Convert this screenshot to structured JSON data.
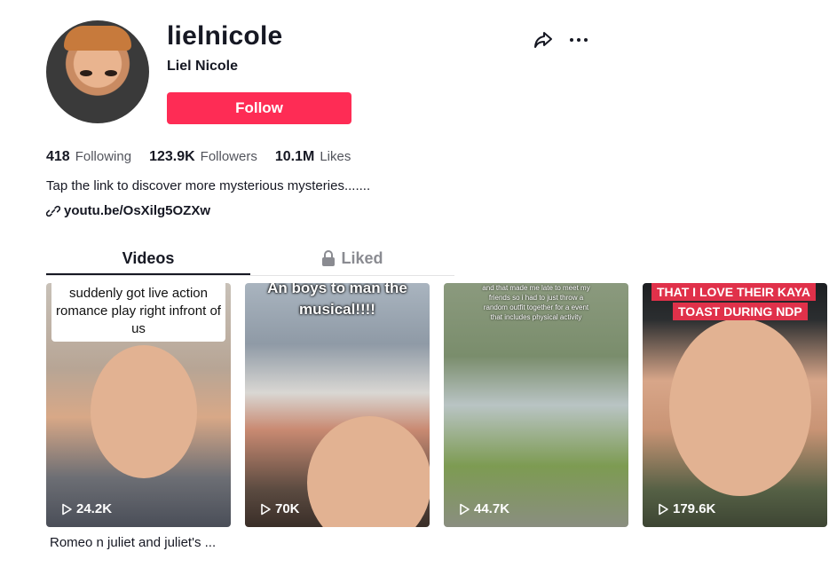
{
  "profile": {
    "username": "lielnicole",
    "nickname": "Liel Nicole",
    "follow_label": "Follow",
    "bio": "Tap the link to discover more mysterious mysteries.......",
    "link": "youtu.be/OsXilg5OZXw"
  },
  "stats": {
    "following_count": "418",
    "following_label": "Following",
    "followers_count": "123.9K",
    "followers_label": "Followers",
    "likes_count": "10.1M",
    "likes_label": "Likes"
  },
  "tabs": {
    "videos": "Videos",
    "liked": "Liked"
  },
  "videos": [
    {
      "caption": "suddenly got live action romance play right infront of us",
      "views": "24.2K",
      "description": "Romeo n juliet and juliet's ..."
    },
    {
      "caption": "An boys to man the musical!!!!",
      "views": "70K"
    },
    {
      "caption": "and that made me late to meet my friends so i had to just throw a random outfit together for a event that includes physical activity",
      "views": "44.7K"
    },
    {
      "caption_line1": "THAT I LOVE THEIR KAYA",
      "caption_line2": "TOAST DURING NDP",
      "views": "179.6K"
    }
  ],
  "icons": {
    "share": "share-icon",
    "more": "more-icon",
    "link": "link-icon",
    "lock": "lock-icon",
    "play": "play-icon"
  },
  "colors": {
    "follow_button": "#fe2c55",
    "text": "#161823",
    "caption_banner": "#e0314a"
  }
}
